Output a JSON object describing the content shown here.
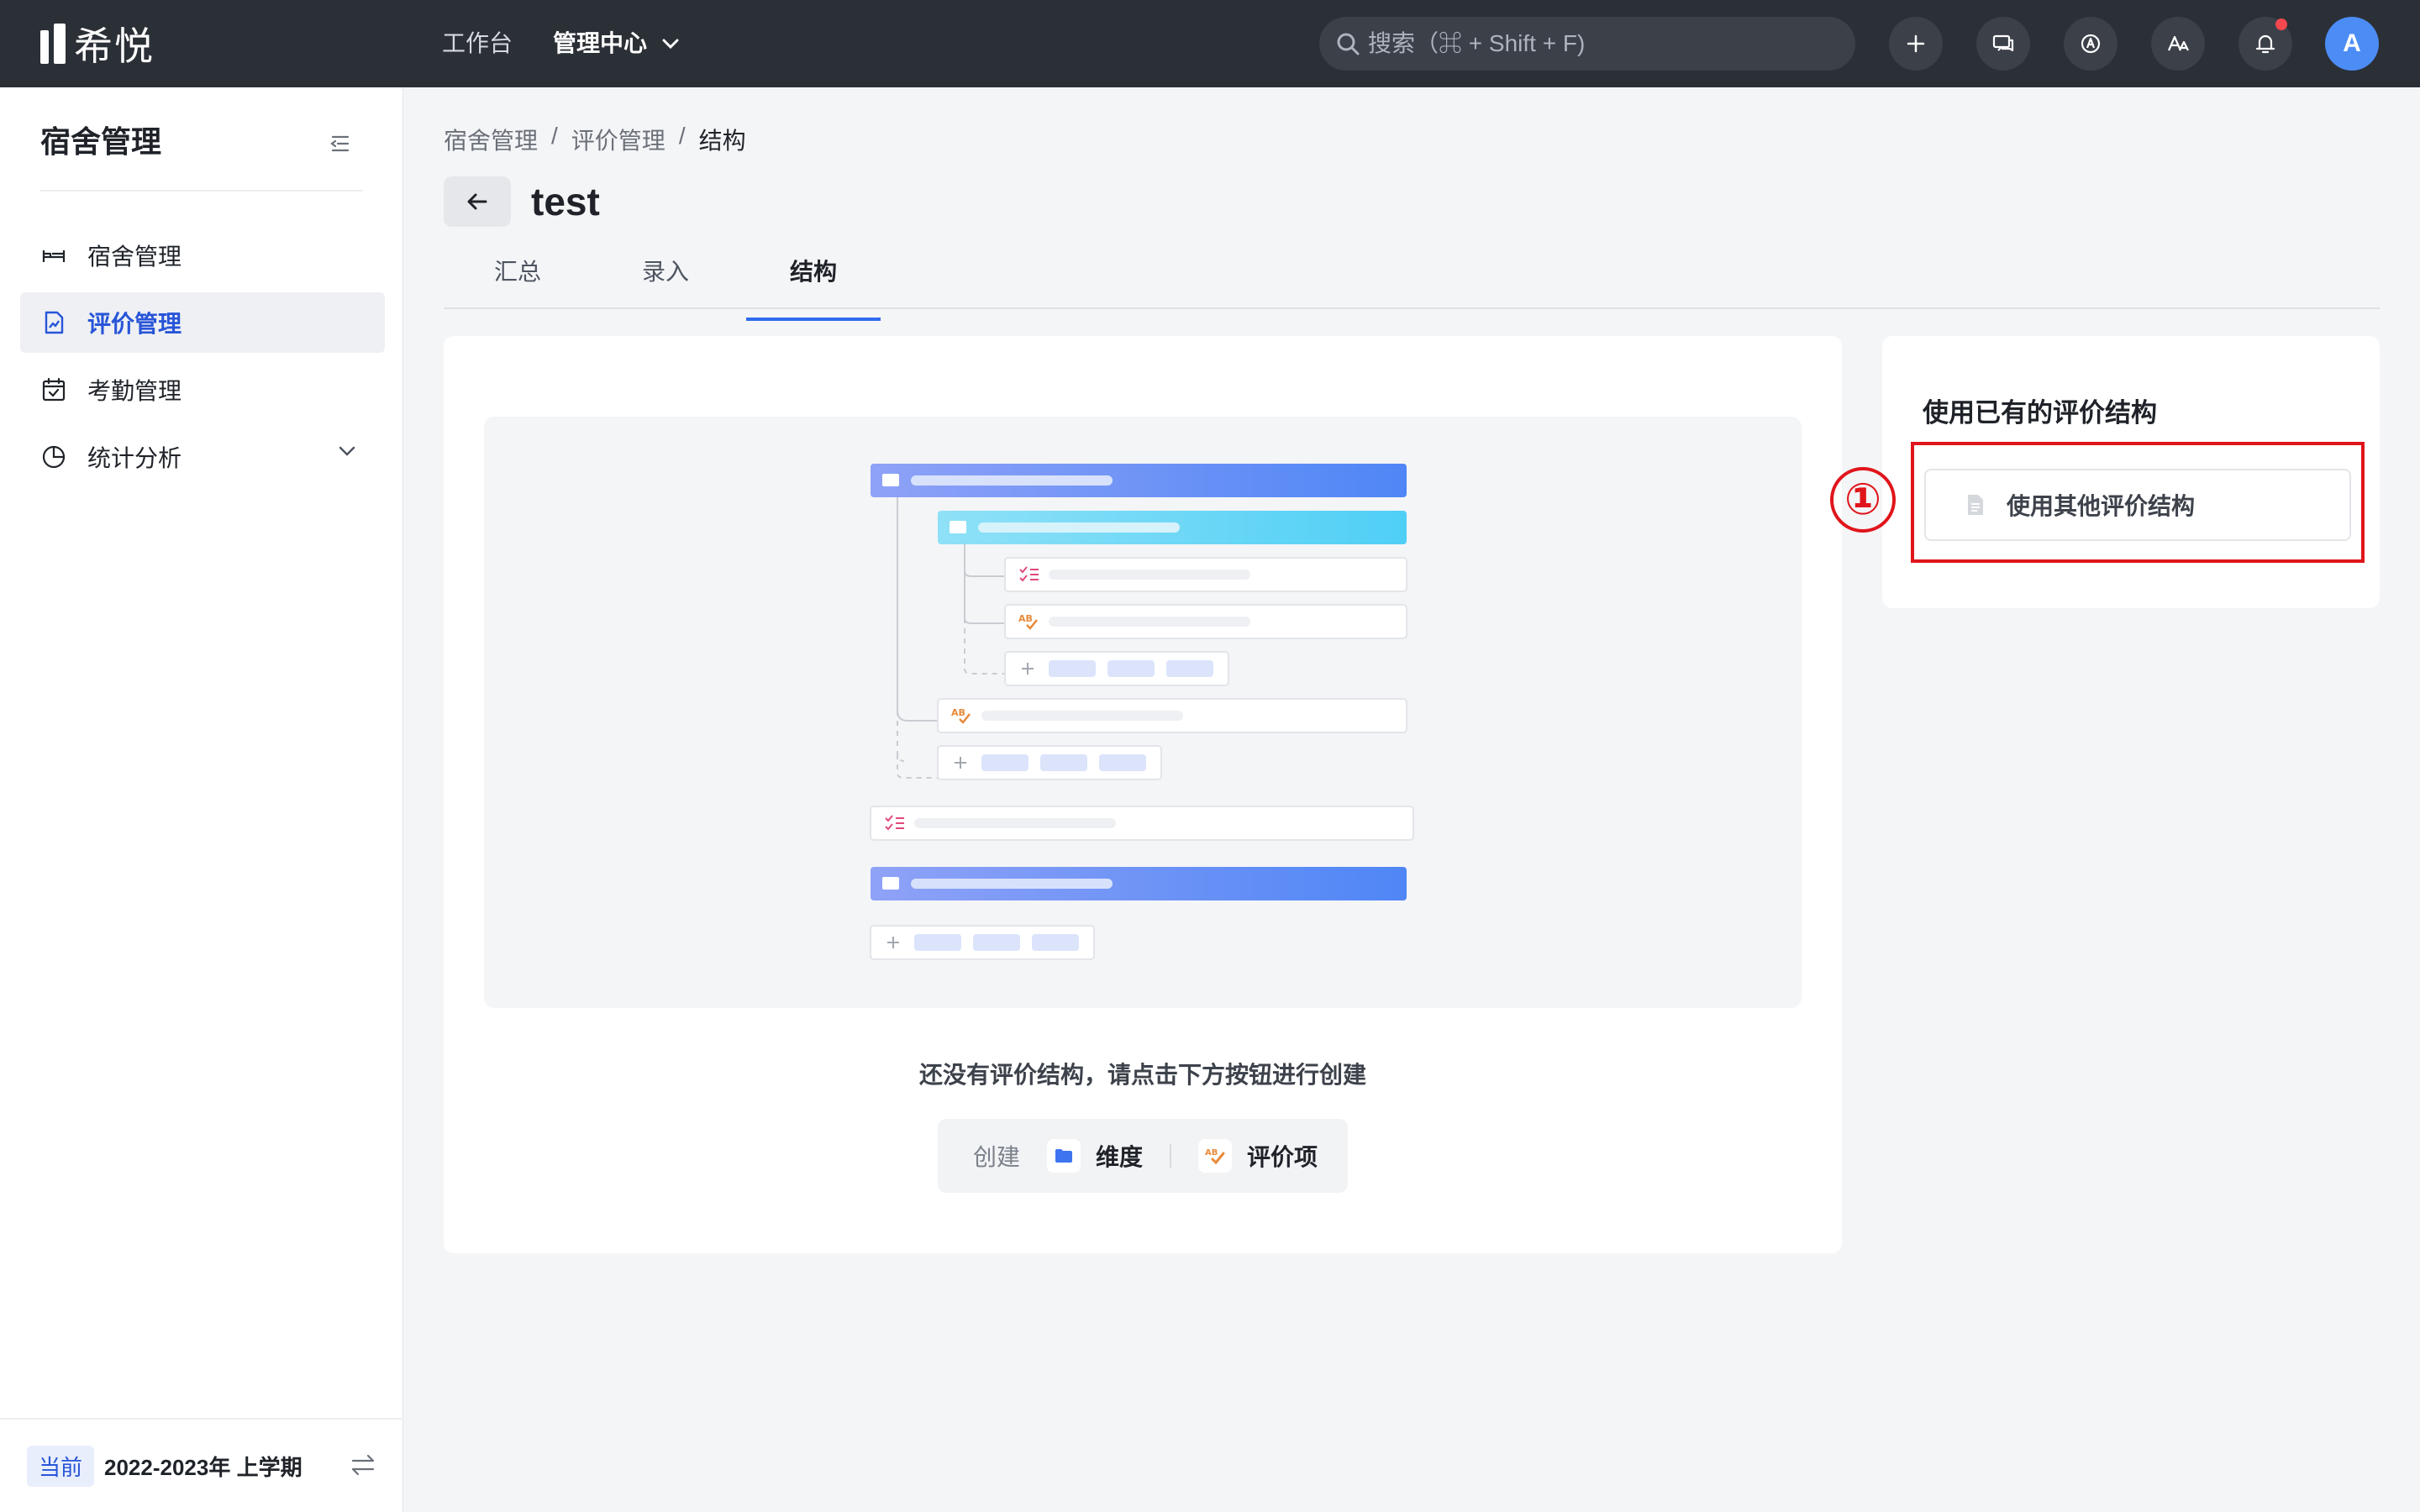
{
  "app": {
    "logo_text": "希悦"
  },
  "topnav": {
    "workbench": "工作台",
    "admin_center": "管理中心"
  },
  "search": {
    "placeholder": "搜索（⌘ + Shift + F)"
  },
  "topbar_icons": [
    "plus-icon",
    "chat-icon",
    "compass-icon",
    "font-icon",
    "bell-icon"
  ],
  "avatar": {
    "initial": "A",
    "color": "#4c8cf5"
  },
  "sidebar": {
    "title": "宿舍管理",
    "items": [
      {
        "label": "宿舍管理",
        "icon": "bed-icon"
      },
      {
        "label": "评价管理",
        "icon": "evaluation-icon",
        "active": true
      },
      {
        "label": "考勤管理",
        "icon": "calendar-icon"
      },
      {
        "label": "统计分析",
        "icon": "pie-chart-icon"
      }
    ],
    "footer": {
      "badge": "当前",
      "term": "2022-2023年 上学期"
    }
  },
  "breadcrumb": {
    "level1": "宿舍管理",
    "level2": "评价管理",
    "level3": "结构",
    "separator": "/"
  },
  "page": {
    "title": "test"
  },
  "tabs": [
    {
      "label": "汇总"
    },
    {
      "label": "录入"
    },
    {
      "label": "结构",
      "active": true
    }
  ],
  "empty_state": {
    "message": "还没有评价结构，请点击下方按钮进行创建",
    "create_label": "创建",
    "dimension_label": "维度",
    "item_label": "评价项"
  },
  "side_card": {
    "title": "使用已有的评价结构",
    "button_label": "使用其他评价结构"
  },
  "annotation": {
    "marker": "①",
    "color": "#e0151b"
  },
  "colors": {
    "accent": "#2f6bf0",
    "topbar": "#2b2f36"
  }
}
